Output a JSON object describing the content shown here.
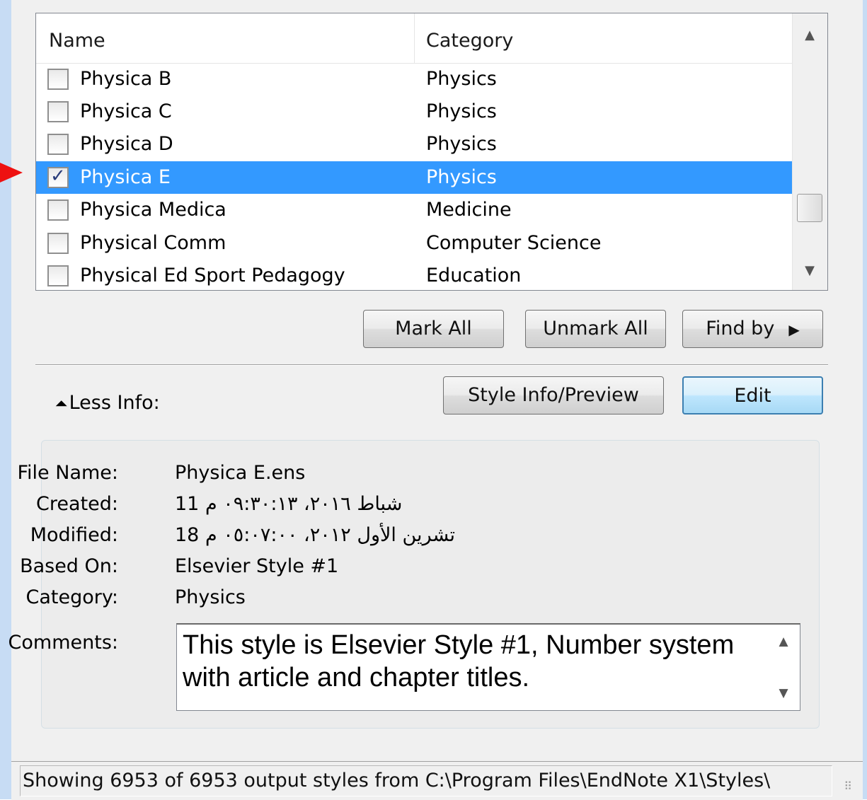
{
  "list": {
    "headers": {
      "name": "Name",
      "category": "Category"
    },
    "rows": [
      {
        "name": "Physica B",
        "category": "Physics",
        "checked": false,
        "selected": false
      },
      {
        "name": "Physica C",
        "category": "Physics",
        "checked": false,
        "selected": false
      },
      {
        "name": "Physica D",
        "category": "Physics",
        "checked": false,
        "selected": false
      },
      {
        "name": "Physica E",
        "category": "Physics",
        "checked": true,
        "selected": true
      },
      {
        "name": "Physica Medica",
        "category": "Medicine",
        "checked": false,
        "selected": false
      },
      {
        "name": "Physical Comm",
        "category": "Computer Science",
        "checked": false,
        "selected": false
      },
      {
        "name": "Physical Ed Sport Pedagogy",
        "category": "Education",
        "checked": false,
        "selected": false
      }
    ]
  },
  "buttons": {
    "mark_all": "Mark All",
    "unmark_all": "Unmark All",
    "find_by": "Find by",
    "style_info": "Style Info/Preview",
    "edit": "Edit"
  },
  "less_info": "Less Info:",
  "info": {
    "file_name_label": "File Name:",
    "file_name": "Physica E.ens",
    "created_label": "Created:",
    "created": "شباط ٢٠١٦، ٠٩:٣٠:١٣ م 11",
    "modified_label": "Modified:",
    "modified": "تشرين الأول ٢٠١٢، ٠٥:٠٧:٠٠ م 18",
    "based_on_label": "Based On:",
    "based_on": "Elsevier Style #1",
    "category_label": "Category:",
    "category": "Physics",
    "comments_label": "Comments:",
    "comments": "This style is Elsevier Style #1, Number system with article and chapter titles."
  },
  "status": "Showing 6953 of 6953 output styles from C:\\Program Files\\EndNote X1\\Styles\\",
  "colors": {
    "selection": "#3399ff",
    "frame": "#c7dcf4",
    "marker": "#ee1111"
  }
}
